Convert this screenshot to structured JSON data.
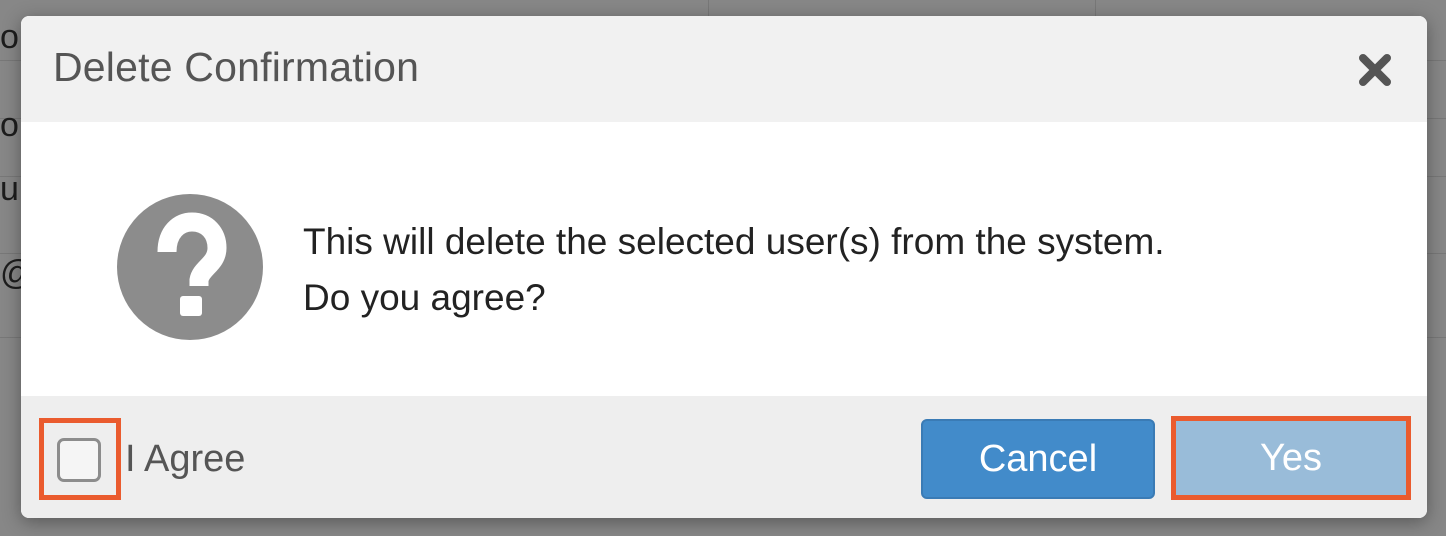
{
  "background": {
    "fragments": [
      "o",
      "or",
      "up",
      "@f"
    ]
  },
  "dialog": {
    "title": "Delete Confirmation",
    "close_icon": "close-icon",
    "question_icon": "question-circle-icon",
    "message_line1": "This will delete the selected user(s) from the system.",
    "message_line2": "Do you agree?",
    "agree_label": "I Agree",
    "agree_checked": false,
    "cancel_label": "Cancel",
    "yes_label": "Yes",
    "yes_enabled": false
  },
  "colors": {
    "primary": "#428bca",
    "primary_disabled": "#99bcd9",
    "highlight": "#ea5b2e",
    "icon_gray": "#8c8c8c"
  }
}
